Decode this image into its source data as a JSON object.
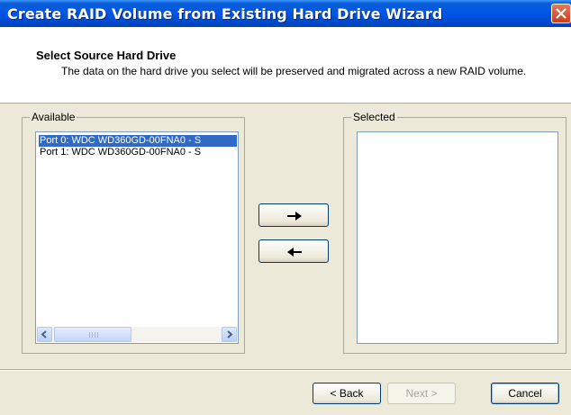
{
  "window": {
    "title": "Create RAID Volume from Existing Hard Drive Wizard",
    "close_icon": "close-icon"
  },
  "header": {
    "title": "Select Source Hard Drive",
    "description": "The data on the hard drive you select will be preserved and migrated across a new RAID volume."
  },
  "available": {
    "legend": "Available",
    "items": [
      {
        "label": "Port 0: WDC WD360GD-00FNA0 - S",
        "selected": true
      },
      {
        "label": "Port 1: WDC WD360GD-00FNA0 - S",
        "selected": false
      }
    ]
  },
  "selected": {
    "legend": "Selected",
    "items": []
  },
  "controls": {
    "add_icon": "arrow-right-icon",
    "remove_icon": "arrow-left-icon"
  },
  "footer": {
    "back_label": "< Back",
    "next_label": "Next >",
    "cancel_label": "Cancel"
  },
  "colors": {
    "titlebar": "#0055e5",
    "selection": "#316ac5",
    "face": "#ece9d8"
  }
}
